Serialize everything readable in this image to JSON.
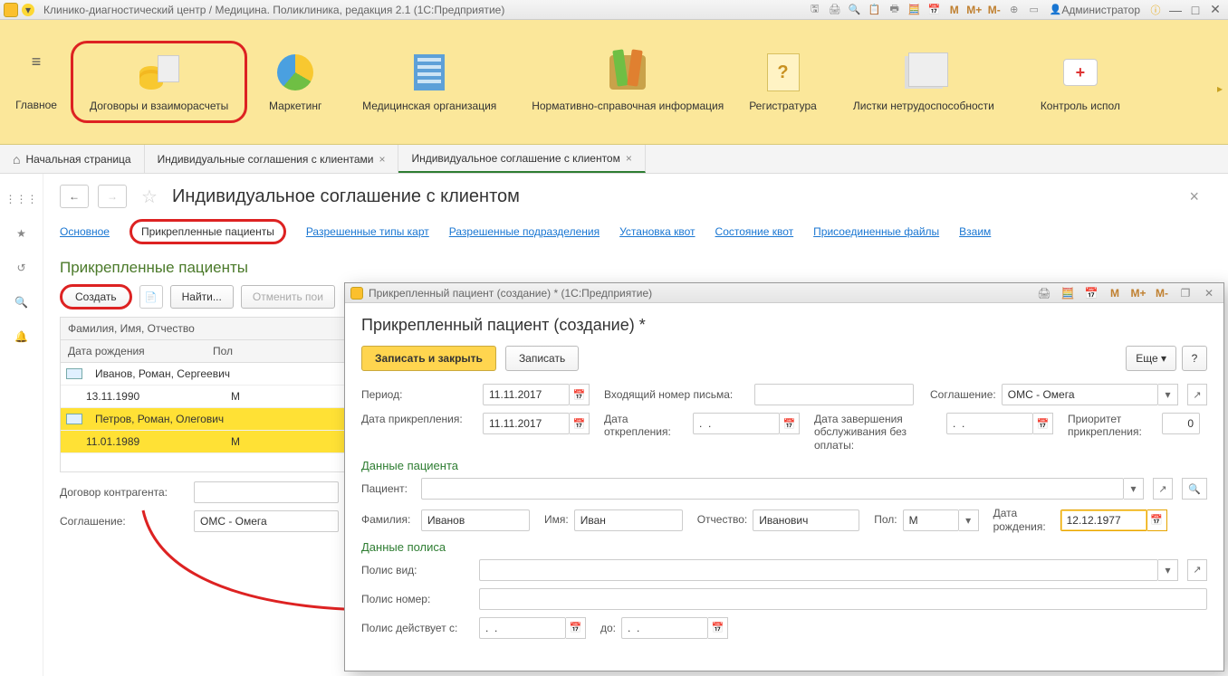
{
  "titlebar": {
    "title": "Клинико-диагностический центр / Медицина. Поликлиника, редакция 2.1  (1С:Предприятие)",
    "m": "M",
    "mplus": "M+",
    "mminus": "M-",
    "admin": "Администратор"
  },
  "toolbar": {
    "glavnoe": "Главное",
    "dogovory": "Договоры и взаиморасчеты",
    "marketing": "Маркетинг",
    "medorg": "Медицинская организация",
    "normat": "Нормативно-справочная информация",
    "registr": "Регистратура",
    "listki": "Листки нетрудоспособности",
    "kontrol": "Контроль испол"
  },
  "tabs": {
    "home": "Начальная страница",
    "tab1": "Индивидуальные соглашения с клиентами",
    "tab2": "Индивидуальное соглашение с клиентом"
  },
  "page": {
    "title": "Индивидуальное соглашение с клиентом",
    "nav": {
      "osnovnoe": "Основное",
      "prikrep": "Прикрепленные пациенты",
      "razresh_tipy": "Разрешенные типы карт",
      "razresh_pod": "Разрешенные подразделения",
      "ust_kvot": "Установка квот",
      "sost_kvot": "Состояние квот",
      "files": "Присоединенные файлы",
      "vzaim": "Взаим"
    },
    "section": "Прикрепленные пациенты",
    "create": "Создать",
    "find": "Найти...",
    "cancel": "Отменить пои",
    "table": {
      "h_fio": "Фамилия, Имя, Отчество",
      "h_date": "Дата рождения",
      "h_sex": "Пол",
      "rows": [
        {
          "fio": "Иванов, Роман, Сергеевич",
          "date": "13.11.1990",
          "sex": "М"
        },
        {
          "fio": "Петров, Роман, Олегович",
          "date": "11.01.1989",
          "sex": "М"
        }
      ]
    },
    "dogovor_label": "Договор контрагента:",
    "soglash_label": "Соглашение:",
    "soglash_val": "ОМС - Омега"
  },
  "modal": {
    "title": "Прикрепленный пациент (создание) *  (1С:Предприятие)",
    "m": "M",
    "mplus": "M+",
    "mminus": "M-",
    "heading": "Прикрепленный пациент (создание) *",
    "save_close": "Записать и закрыть",
    "save": "Записать",
    "more": "Еще",
    "q": "?",
    "period_lbl": "Период:",
    "period_val": "11.11.2017",
    "inbox_lbl": "Входящий номер письма:",
    "soglash_lbl": "Соглашение:",
    "soglash_val": "ОМС - Омега",
    "attach_date_lbl": "Дата прикрепления:",
    "attach_date_val": "11.11.2017",
    "detach_date_lbl": "Дата открепления:",
    "detach_date_val": ".  .",
    "service_end_lbl": "Дата завершения обслуживания без оплаты:",
    "service_end_val": ".  .",
    "priority_lbl": "Приоритет прикрепления:",
    "priority_val": "0",
    "section1": "Данные пациента",
    "patient_lbl": "Пациент:",
    "fam_lbl": "Фамилия:",
    "fam_val": "Иванов",
    "imya_lbl": "Имя:",
    "imya_val": "Иван",
    "otch_lbl": "Отчество:",
    "otch_val": "Иванович",
    "pol_lbl": "Пол:",
    "pol_val": "М",
    "dob_lbl": "Дата рождения:",
    "dob_val": "12.12.1977",
    "section2": "Данные полиса",
    "polis_vid_lbl": "Полис вид:",
    "polis_nomer_lbl": "Полис номер:",
    "polis_from_lbl": "Полис действует с:",
    "polis_from_val": ".  .",
    "polis_to_lbl": "до:",
    "polis_to_val": ".  ."
  }
}
